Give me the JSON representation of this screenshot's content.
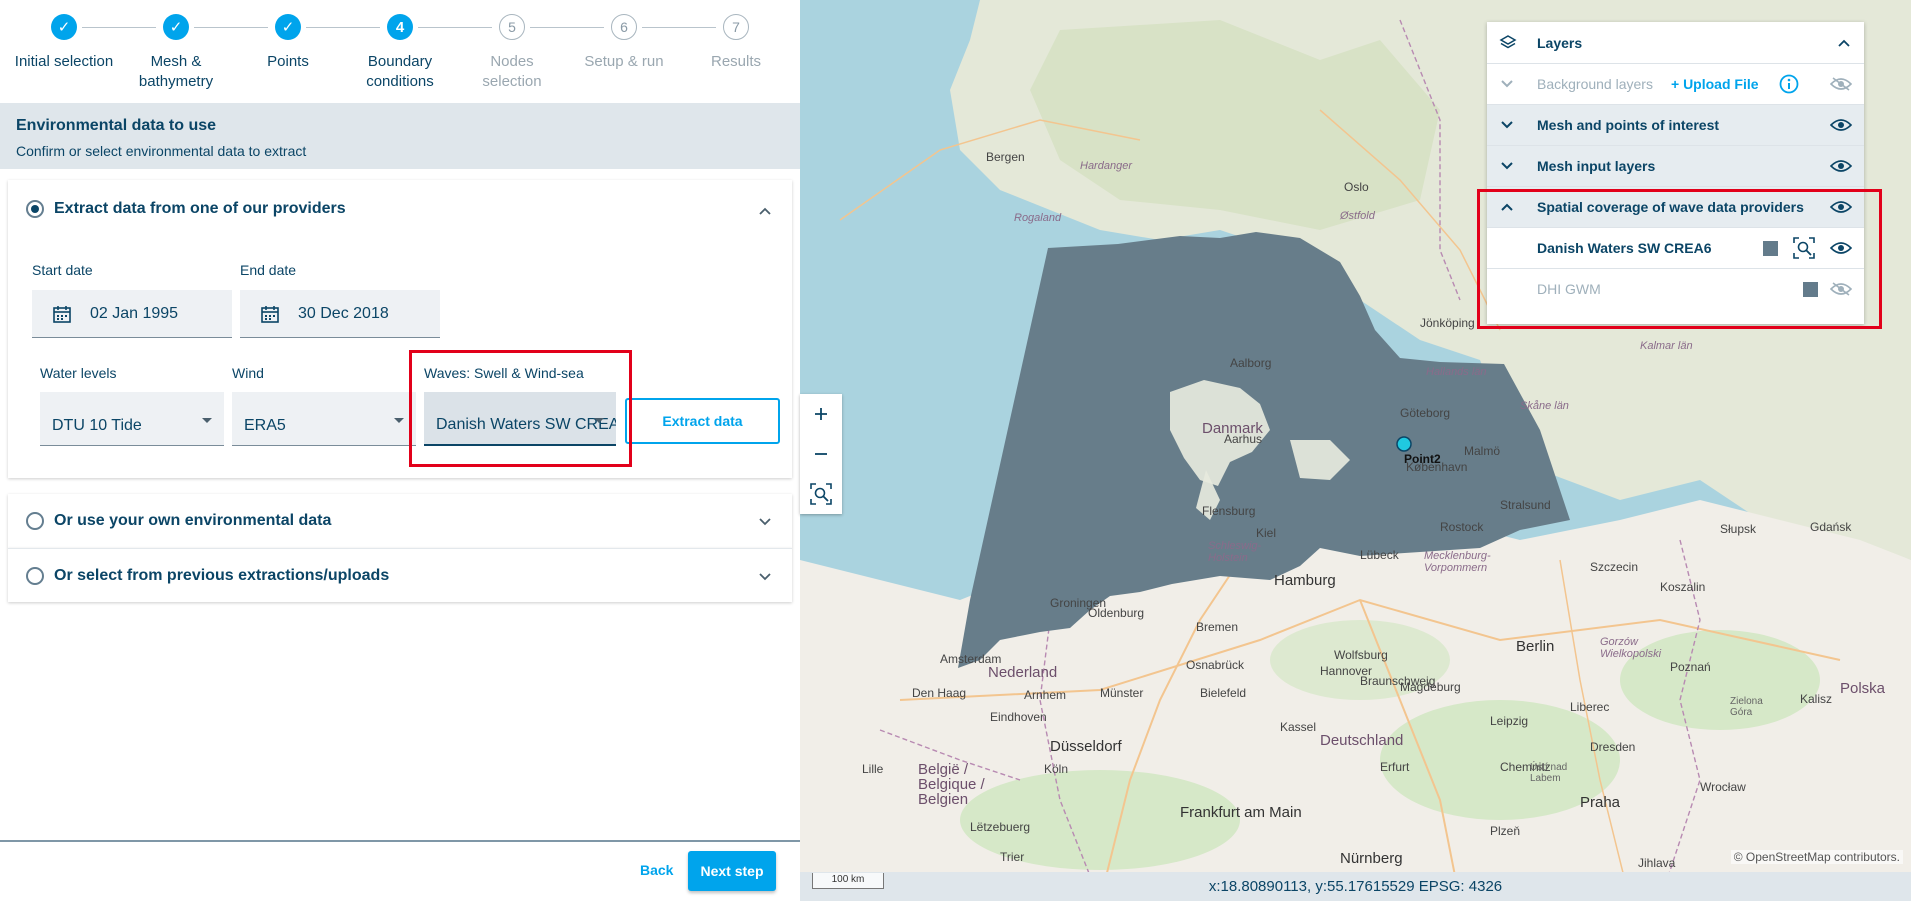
{
  "stepper": {
    "steps": [
      {
        "number": "1",
        "label": "Initial selection",
        "state": "done"
      },
      {
        "number": "2",
        "label": "Mesh &\nbathymetry",
        "state": "done"
      },
      {
        "number": "3",
        "label": "Points",
        "state": "done"
      },
      {
        "number": "4",
        "label": "Boundary\nconditions",
        "state": "current"
      },
      {
        "number": "5",
        "label": "Nodes\nselection",
        "state": "todo"
      },
      {
        "number": "6",
        "label": "Setup & run",
        "state": "todo"
      },
      {
        "number": "7",
        "label": "Results",
        "state": "todo"
      }
    ],
    "check_glyph": "✓"
  },
  "env": {
    "title": "Environmental data to use",
    "subtitle": "Confirm or select environmental data to extract"
  },
  "providers": {
    "label": "Extract data from one of our providers",
    "start_label": "Start date",
    "start_value": "02 Jan 1995",
    "end_label": "End date",
    "end_value": "30 Dec 2018",
    "water_label": "Water levels",
    "water_value": "DTU 10 Tide",
    "wind_label": "Wind",
    "wind_value": "ERA5",
    "waves_label": "Waves: Swell & Wind-sea",
    "waves_value": "Danish Waters SW CREA6",
    "extract_label": "Extract data"
  },
  "own_data": {
    "label": "Or use your own environmental data"
  },
  "previous": {
    "label": "Or select from previous extractions/uploads"
  },
  "footer": {
    "back": "Back",
    "next": "Next step"
  },
  "layers": {
    "title": "Layers",
    "background": "Background layers",
    "upload": "+ Upload File",
    "mesh_points": "Mesh and points of interest",
    "mesh_input": "Mesh input layers",
    "spatial": "Spatial coverage of wave data providers",
    "danish": "Danish Waters SW CREA6",
    "dhi": "DHI GWM"
  },
  "map": {
    "point_label": "Point2",
    "coords": "x:18.80890113, y:55.17615529  EPSG: 4326",
    "scale": "100 km",
    "attribution": "© OpenStreetMap contributors.",
    "places": {
      "bergen": "Bergen",
      "oslo": "Oslo",
      "rogaland": "Rogaland",
      "aalborg": "Aalborg",
      "danmark": "Danmark",
      "kobenhavn": "København",
      "hamburg": "Hamburg",
      "bremen": "Bremen",
      "berlin": "Berlin",
      "nederland": "Nederland",
      "den_haag": "Den Haag",
      "deutschland": "Deutschland",
      "koszalin": "Koszalin",
      "slupsk": "Słupsk",
      "gdansk": "Gdańsk",
      "szczecin": "Szczecin",
      "hannover": "Hannover",
      "leipzig": "Leipzig",
      "dusseldorf": "Düsseldorf",
      "frankfurt": "Frankfurt am Main",
      "belgie": "België /\nBelgique /\nBelgien",
      "praha": "Praha",
      "nurnberg": "Nürnberg",
      "dresden": "Dresden",
      "amsterdam": "Amsterdam",
      "groningen": "Groningen",
      "oldenburg": "Oldenburg",
      "kiel": "Kiel",
      "flensburg": "Flensburg",
      "goteborg": "Göteborg",
      "jonkoping": "Jönköping",
      "halland": "Hallands län",
      "schleswig": "Schleswig-\nHolstein",
      "mecklenburg": "Mecklenburg-\nVorpommern",
      "polska": "Polska",
      "poznan": "Poznań",
      "lille": "Lille",
      "koln": "Köln",
      "luxembourg": "Lëtzebuerg",
      "malmo": "Malmö",
      "hardanger": "Hardanger",
      "ostfold": "Østfold",
      "skane": "Skåne län",
      "kalmar": "Kalmar län",
      "kassel": "Kassel",
      "magdeburg": "Magdeburg",
      "chemnitz": "Chemnitz",
      "erfurt": "Erfurt",
      "wroclaw": "Wrocław",
      "bielefeld": "Bielefeld",
      "osnabruck": "Osnabrück",
      "eindhoven": "Eindhoven",
      "arnhem": "Arnhem",
      "munster": "Münster",
      "rostock": "Rostock",
      "stralsund": "Stralsund",
      "gorzow": "Gorzów\nWielkopolski",
      "zielona": "Zielona\nGóra",
      "kalisz": "Kalisz",
      "liberec": "Liberec",
      "jihlava": "Jihlava",
      "plzen": "Plzeň",
      "usti": "Ústí nad\nLabem",
      "trier": "Trier",
      "wolfsburg": "Wolfsburg",
      "braunschweig": "Braunschweig",
      "lubeck": "Lübeck",
      "aarhus": "Aarhus"
    }
  },
  "colors": {
    "accent": "#00a4ec",
    "primary": "#0b4566",
    "coverage": "#637b8b",
    "highlight": "#e2001a"
  }
}
